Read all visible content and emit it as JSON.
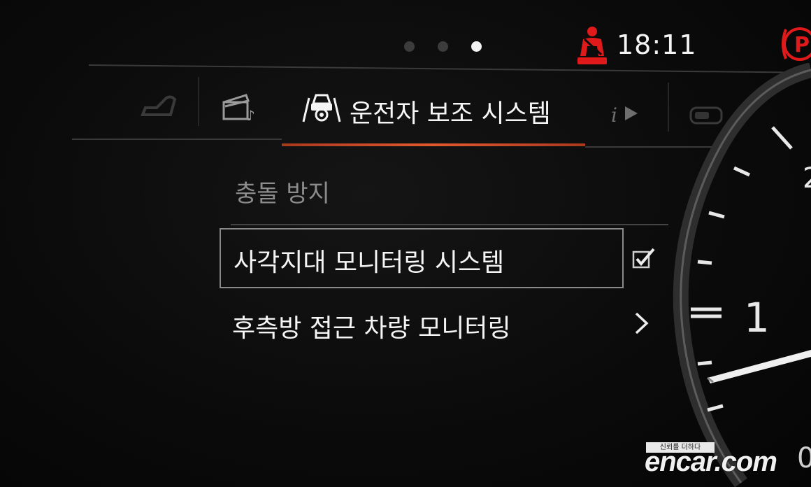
{
  "pager": {
    "count": 3,
    "active_index": 2
  },
  "status": {
    "time": "18:11",
    "seatbelt_icon": "seatbelt-warning-icon",
    "parking_icon": "parking-brake-icon",
    "warning_color": "#e01a1a"
  },
  "tabs": {
    "items": [
      {
        "icon": "seat-icon"
      },
      {
        "icon": "media-clapperboard-icon"
      },
      {
        "icon": "driver-assist-icon",
        "label": "운전자 보조 시스템",
        "active": true
      },
      {
        "icon": "info-play-icon"
      },
      {
        "icon": "battery-icon"
      }
    ],
    "accent_color": "#e05a2a"
  },
  "menu": {
    "section_label": "충돌 방지",
    "items": [
      {
        "label": "사각지대 모니터링 시스템",
        "control": "checkbox",
        "checked": true,
        "selected": true
      },
      {
        "label": "후측방 접근 차량 모니터링",
        "control": "chevron",
        "selected": false
      }
    ]
  },
  "gauge": {
    "visible_numbers": [
      "2",
      "1",
      "0"
    ]
  },
  "watermark": {
    "tagline": "신뢰를 더하다",
    "logo": "encar.com"
  }
}
